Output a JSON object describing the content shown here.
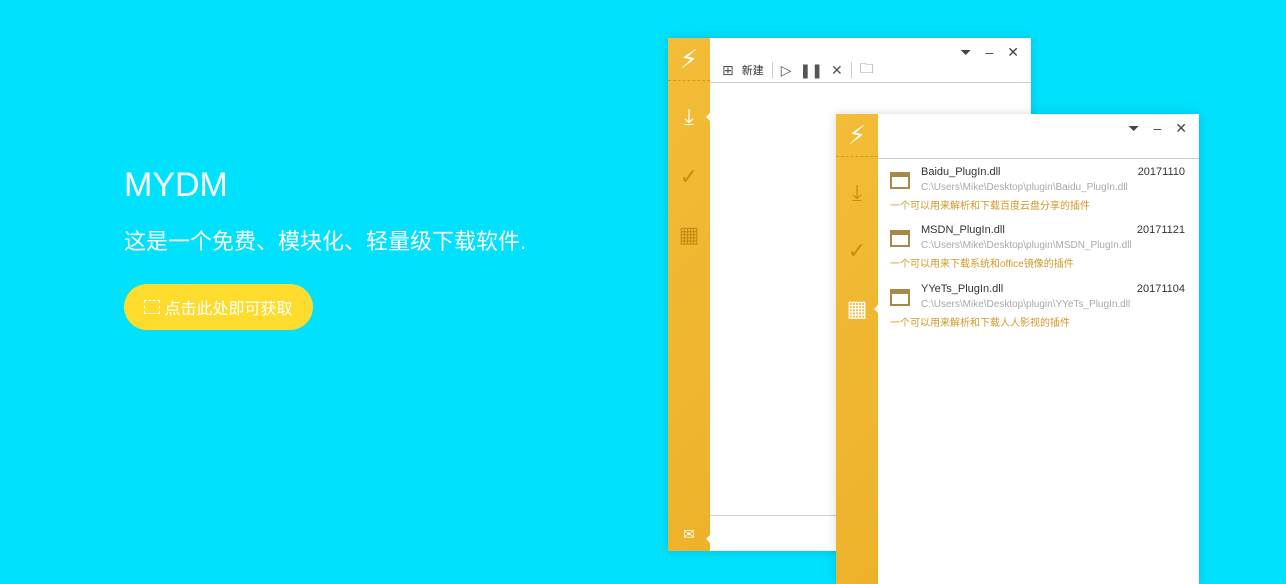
{
  "hero": {
    "title": "MYDM",
    "subtitle": "这是一个免费、模块化、轻量级下载软件.",
    "cta": "点击此处即可获取"
  },
  "window1": {
    "toolbar": {
      "new_label": "新建"
    }
  },
  "window2": {
    "plugins": [
      {
        "name": "Baidu_PlugIn.dll",
        "path": "C:\\Users\\Mike\\Desktop\\plugin\\Baidu_PlugIn.dll",
        "desc": "一个可以用来解析和下载百度云盘分享的插件",
        "date": "20171110"
      },
      {
        "name": "MSDN_PlugIn.dll",
        "path": "C:\\Users\\Mike\\Desktop\\plugin\\MSDN_PlugIn.dll",
        "desc": "一个可以用来下载系统和office镜像的插件",
        "date": "20171121"
      },
      {
        "name": "YYeTs_PlugIn.dll",
        "path": "C:\\Users\\Mike\\Desktop\\plugin\\YYeTs_PlugIn.dll",
        "desc": "一个可以用来解析和下载人人影视的插件",
        "date": "20171104"
      }
    ]
  },
  "colors": {
    "background": "#00e1fe",
    "accent": "#f0b830",
    "cta": "#fddc2d"
  }
}
